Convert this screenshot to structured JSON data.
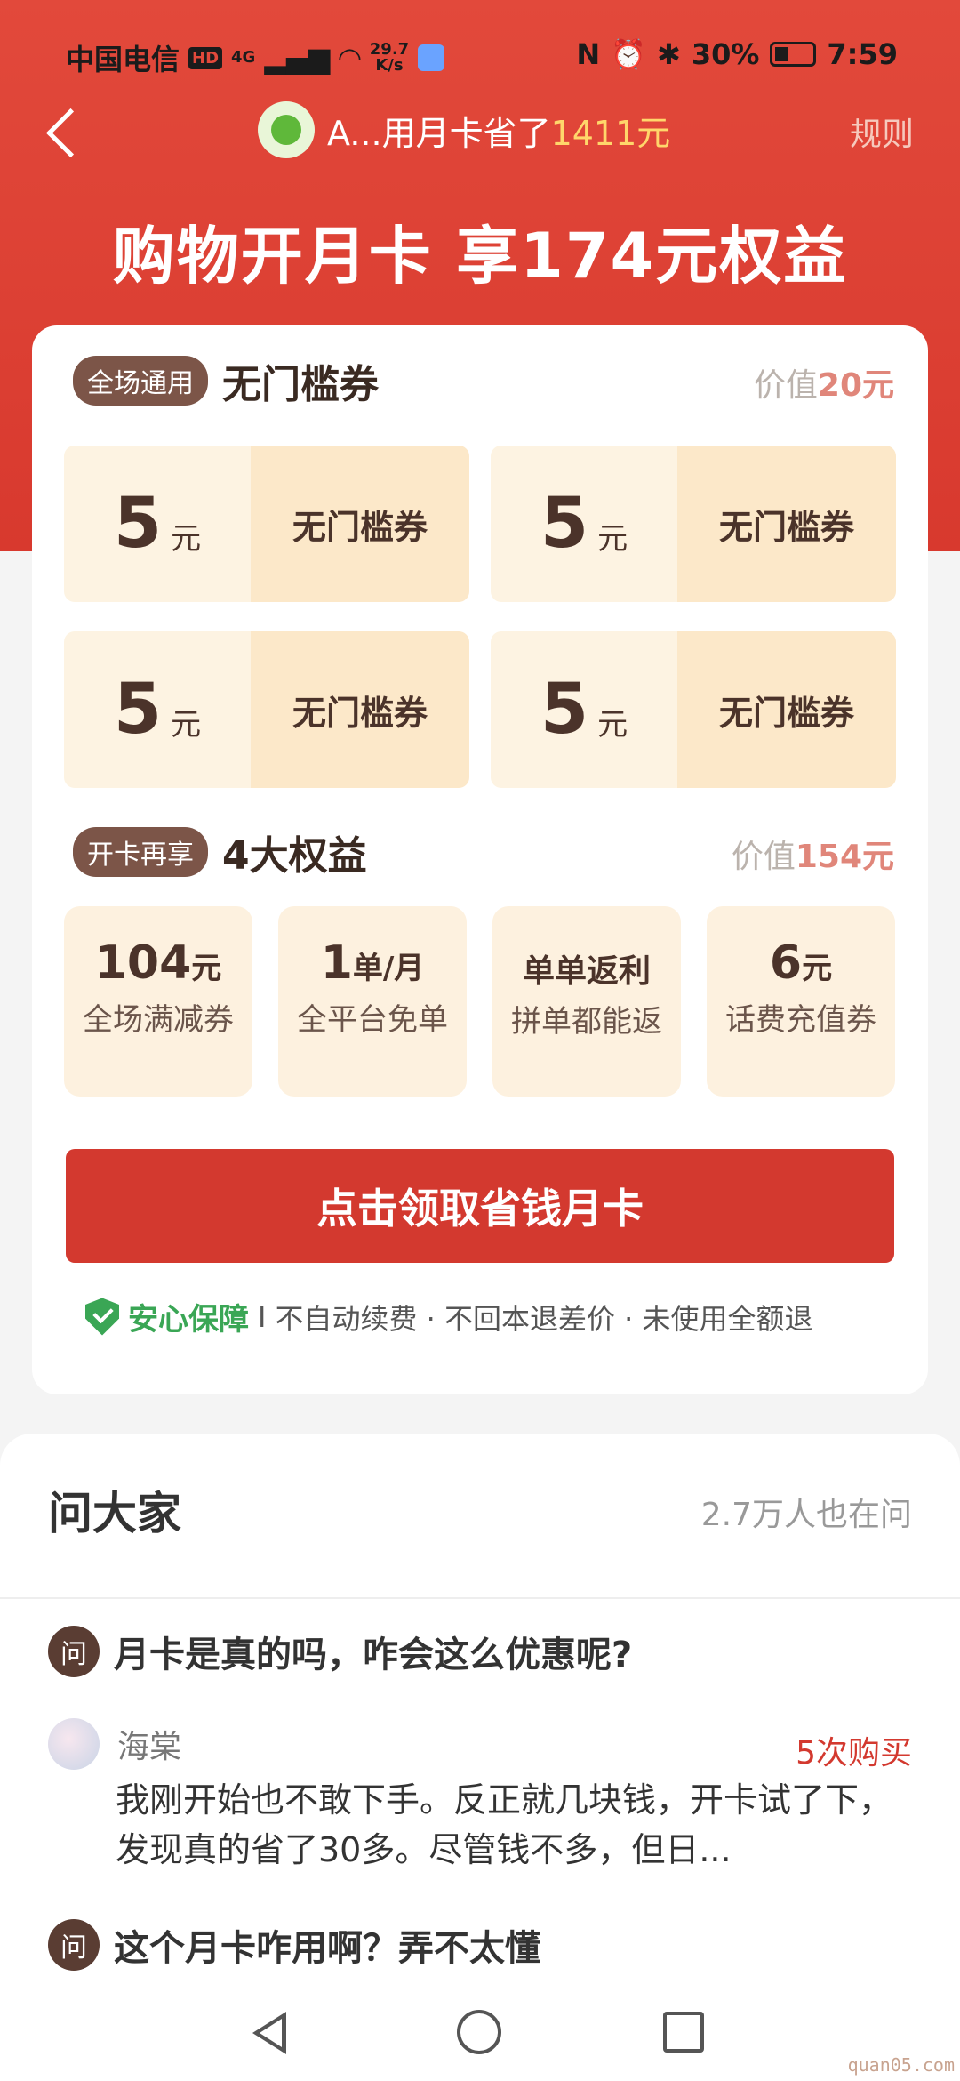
{
  "status_bar": {
    "carrier": "中国电信",
    "hd": "HD",
    "network": "4G",
    "speed_value": "29.7",
    "speed_unit": "K/s",
    "battery": "30%",
    "time": "7:59"
  },
  "nav": {
    "user_prefix": "A...用月卡省了",
    "saved_amount": "1411元",
    "rules_label": "规则"
  },
  "headline": "购物开月卡 享174元权益",
  "section_coupons": {
    "tag": "全场通用",
    "title": "无门槛券",
    "value_prefix": "价值",
    "value_amount": "20元",
    "coupons": [
      {
        "amount": "5",
        "unit": "元",
        "label": "无门槛券"
      },
      {
        "amount": "5",
        "unit": "元",
        "label": "无门槛券"
      },
      {
        "amount": "5",
        "unit": "元",
        "label": "无门槛券"
      },
      {
        "amount": "5",
        "unit": "元",
        "label": "无门槛券"
      }
    ]
  },
  "section_benefits": {
    "tag": "开卡再享",
    "title": "4大权益",
    "value_prefix": "价值",
    "value_amount": "154元",
    "items": [
      {
        "big": "104",
        "unit": "元",
        "sub": "全场满减券"
      },
      {
        "big": "1",
        "unit": "单/月",
        "sub": "全平台免单"
      },
      {
        "big": "",
        "unit": "单单返利",
        "sub": "拼单都能返"
      },
      {
        "big": "6",
        "unit": "元",
        "sub": "话费充值券"
      }
    ]
  },
  "cta_label": "点击领取省钱月卡",
  "guarantee": {
    "title": "安心保障",
    "sep": "I",
    "text": "不自动续费 · 不回本退差价 · 未使用全额退"
  },
  "ask": {
    "title": "问大家",
    "count": "2.7万人也在问",
    "badge": "问",
    "question1": "月卡是真的吗，咋会这么优惠呢?",
    "user_name": "海棠",
    "purchases": "5次购买",
    "answer": "我刚开始也不敢下手。反正就几块钱，开卡试了下，发现真的省了30多。尽管钱不多，但日...",
    "question2": "这个月卡咋用啊？弄不太懂"
  },
  "watermark": "quan05.com",
  "colors": {
    "hero_red": "#e2493b",
    "cta_red": "#d3392f",
    "tag_brown": "#7c5548",
    "guarantee_green": "#3aa655",
    "highlight_yellow": "#ffd66b"
  }
}
